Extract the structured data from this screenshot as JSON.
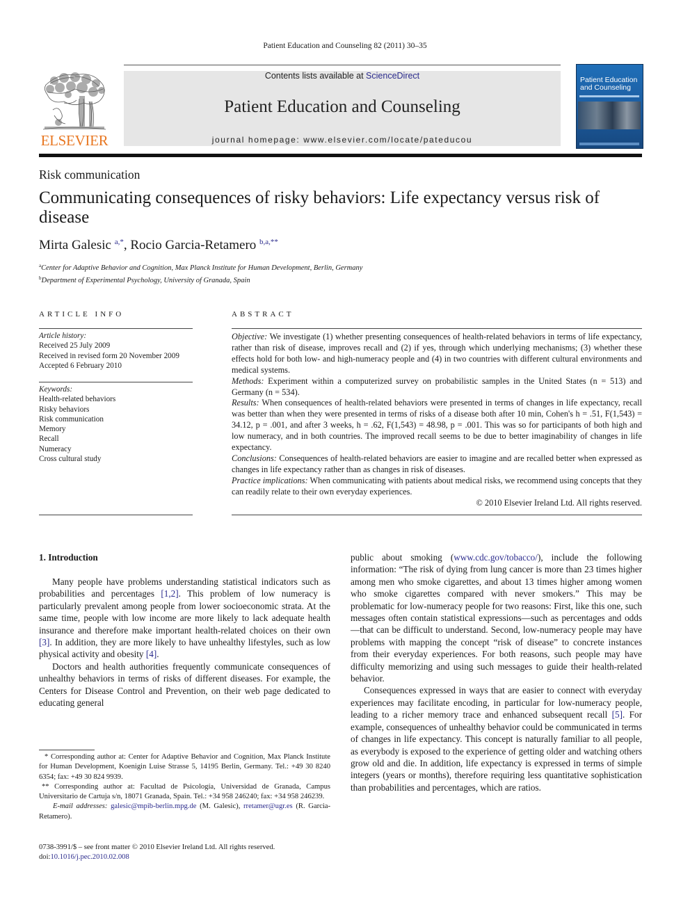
{
  "header": {
    "running_head": "Patient Education and Counseling 82 (2011) 30–35",
    "publisher_logo_text": "ELSEVIER",
    "contents_prefix": "Contents lists available at ",
    "contents_link": "ScienceDirect",
    "journal_title": "Patient Education and Counseling",
    "homepage": "journal homepage: www.elsevier.com/locate/pateducou",
    "cover": {
      "title_line1": "Patient Education",
      "title_line2": "and Counseling",
      "color": "#1f6fb8"
    },
    "accent_color": "#e87722",
    "link_color": "#2b2b8c"
  },
  "article": {
    "section": "Risk communication",
    "title": "Communicating consequences of risky behaviors: Life expectancy versus risk of disease",
    "authors": [
      {
        "name": "Mirta Galesic",
        "sup": "a,*"
      },
      {
        "name": "Rocio Garcia-Retamero",
        "sup": "b,a,**"
      }
    ],
    "author_separator": ", ",
    "affiliations": [
      {
        "key": "a",
        "text": "Center for Adaptive Behavior and Cognition, Max Planck Institute for Human Development, Berlin, Germany"
      },
      {
        "key": "b",
        "text": "Department of Experimental Psychology, University of Granada, Spain"
      }
    ]
  },
  "article_info": {
    "heading": "ARTICLE INFO",
    "history_label": "Article history:",
    "history": [
      "Received 25 July 2009",
      "Received in revised form 20 November 2009",
      "Accepted 6 February 2010"
    ],
    "keywords_label": "Keywords:",
    "keywords": [
      "Health-related behaviors",
      "Risky behaviors",
      "Risk communication",
      "Memory",
      "Recall",
      "Numeracy",
      "Cross cultural study"
    ]
  },
  "abstract": {
    "heading": "ABSTRACT",
    "objective_label": "Objective:",
    "objective": " We investigate (1) whether presenting consequences of health-related behaviors in terms of life expectancy, rather than risk of disease, improves recall and (2) if yes, through which underlying mechanisms; (3) whether these effects hold for both low- and high-numeracy people and (4) in two countries with different cultural environments and medical systems.",
    "methods_label": "Methods:",
    "methods": " Experiment within a computerized survey on probabilistic samples in the United States (n = 513) and Germany (n = 534).",
    "results_label": "Results:",
    "results": " When consequences of health-related behaviors were presented in terms of changes in life expectancy, recall was better than when they were presented in terms of risks of a disease both after 10 min, Cohen's h = .51, F(1,543) = 34.12, p = .001, and after 3 weeks, h = .62, F(1,543) = 48.98, p = .001. This was so for participants of both high and low numeracy, and in both countries. The improved recall seems to be due to better imaginability of changes in life expectancy.",
    "conclusions_label": "Conclusions:",
    "conclusions": " Consequences of health-related behaviors are easier to imagine and are recalled better when expressed as changes in life expectancy rather than as changes in risk of diseases.",
    "practice_label": "Practice implications:",
    "practice": " When communicating with patients about medical risks, we recommend using concepts that they can readily relate to their own everyday experiences.",
    "copyright": "© 2010 Elsevier Ireland Ltd. All rights reserved."
  },
  "body": {
    "section_heading": "1.  Introduction",
    "left_col": {
      "p1_a": "Many people have problems understanding statistical indicators such as probabilities and percentages ",
      "p1_ref1": "[1,2]",
      "p1_b": ". This problem of low numeracy is particularly prevalent among people from lower socioeconomic strata. At the same time, people with low income are more likely to lack adequate health insurance and therefore make important health-related choices on their own ",
      "p1_ref2": "[3]",
      "p1_c": ". In addition, they are more likely to have unhealthy lifestyles, such as low physical activity and obesity ",
      "p1_ref3": "[4]",
      "p1_d": ".",
      "p2": "Doctors and health authorities frequently communicate consequences of unhealthy behaviors in terms of risks of different diseases. For example, the Centers for Disease Control and Prevention, on their web page dedicated to educating general"
    },
    "right_col": {
      "p1_a": "public about smoking (",
      "p1_link": "www.cdc.gov/tobacco/",
      "p1_b": "), include the following information: “The risk of dying from lung cancer is more than 23 times higher among men who smoke cigarettes, and about 13 times higher among women who smoke cigarettes compared with never smokers.” This may be problematic for low-numeracy people for two reasons: First, like this one, such messages often contain statistical expressions—such as percentages and odds—that can be difficult to understand. Second, low-numeracy people may have problems with mapping the concept “risk of disease” to concrete instances from their everyday experiences. For both reasons, such people may have difficulty memorizing and using such messages to guide their health-related behavior.",
      "p2_a": "Consequences expressed in ways that are easier to connect with everyday experiences may facilitate encoding, in particular for low-numeracy people, leading to a richer memory trace and enhanced subsequent recall ",
      "p2_ref": "[5]",
      "p2_b": ". For example, consequences of unhealthy behavior could be communicated in terms of changes in life expectancy. This concept is naturally familiar to all people, as everybody is exposed to the experience of getting older and watching others grow old and die. In addition, life expectancy is expressed in terms of simple integers (years or months), therefore requiring less quantitative sophistication than probabilities and percentages, which are ratios."
    }
  },
  "footnotes": {
    "fn1": "* Corresponding author at: Center for Adaptive Behavior and Cognition, Max Planck Institute for Human Development, Koenigin Luise Strasse 5, 14195 Berlin, Germany. Tel.: +49 30 8240 6354; fax: +49 30 824 9939.",
    "fn2": "** Corresponding author at: Facultad de Psicología, Universidad de Granada, Campus Universitario de Cartuja s/n, 18071 Granada, Spain. Tel.: +34 958 246240; fax: +34 958 246239.",
    "email_label": "E-mail addresses:",
    "email1": "galesic@mpib-berlin.mpg.de",
    "email1_owner": " (M. Galesic), ",
    "email2": "rretamer@ugr.es",
    "email2_owner": " (R. Garcia-Retamero).",
    "issn_line": "0738-3991/$ – see front matter © 2010 Elsevier Ireland Ltd. All rights reserved.",
    "doi_label": "doi:",
    "doi": "10.1016/j.pec.2010.02.008"
  }
}
